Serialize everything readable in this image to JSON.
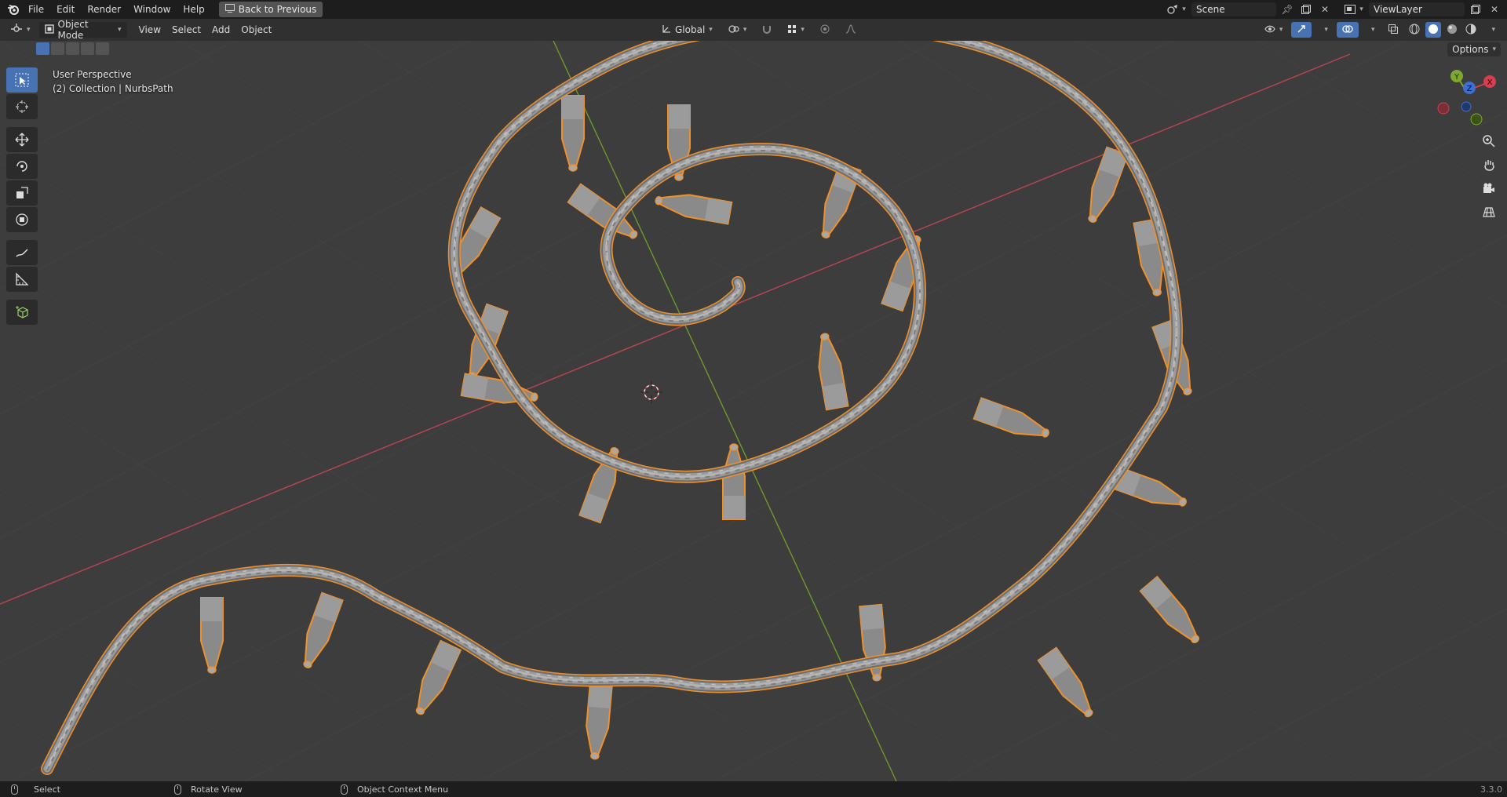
{
  "topbar": {
    "menus": [
      "File",
      "Edit",
      "Render",
      "Window",
      "Help"
    ],
    "back_button": "Back to Previous",
    "scene_name": "Scene",
    "view_layer": "ViewLayer"
  },
  "header": {
    "mode": "Object Mode",
    "menus": [
      "View",
      "Select",
      "Add",
      "Object"
    ],
    "orientation": "Global"
  },
  "viewport": {
    "perspective": "User Perspective",
    "collection": "(2) Collection | NurbsPath",
    "options_label": "Options",
    "gizmo_axes": [
      "X",
      "Y",
      "Z"
    ]
  },
  "statusbar": {
    "select": "Select",
    "rotate": "Rotate View",
    "context": "Object Context Menu",
    "version": "3.3.0"
  },
  "colors": {
    "accent": "#4772b3",
    "selection_outline": "#f0902a",
    "x_axis": "#c4404f",
    "y_axis": "#7fa830",
    "object_gray": "#8a8a8a"
  }
}
